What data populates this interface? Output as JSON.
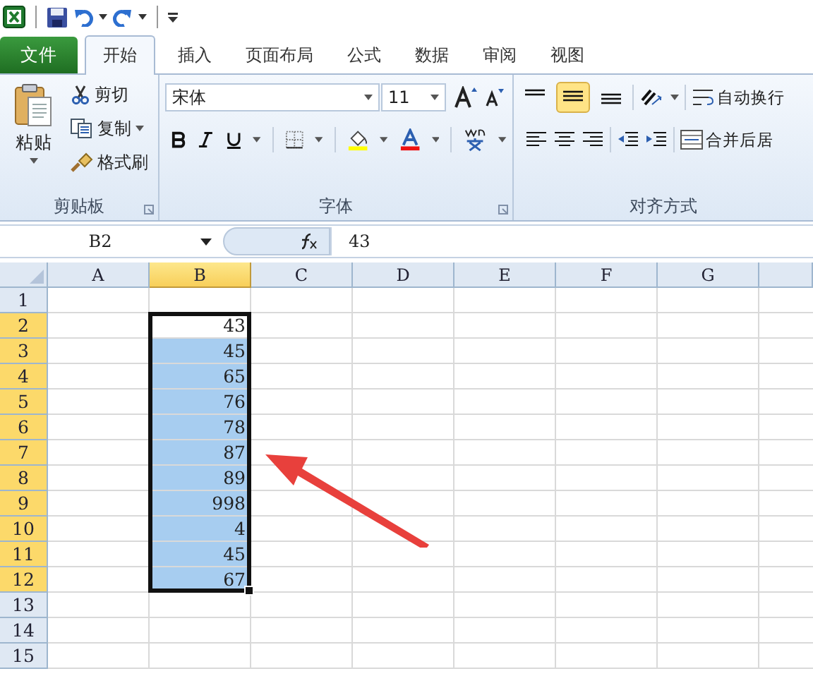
{
  "tabs": [
    {
      "label": "文件",
      "kind": "file",
      "selected": false
    },
    {
      "label": "开始",
      "kind": "tab",
      "selected": true
    },
    {
      "label": "插入",
      "kind": "tab",
      "selected": false
    },
    {
      "label": "页面布局",
      "kind": "tab",
      "selected": false
    },
    {
      "label": "公式",
      "kind": "tab",
      "selected": false
    },
    {
      "label": "数据",
      "kind": "tab",
      "selected": false
    },
    {
      "label": "审阅",
      "kind": "tab",
      "selected": false
    },
    {
      "label": "视图",
      "kind": "tab",
      "selected": false
    }
  ],
  "clipboard": {
    "label": "剪贴板",
    "paste": "粘贴",
    "cut": "剪切",
    "copy": "复制",
    "format_painter": "格式刷"
  },
  "font": {
    "label": "字体",
    "font_name": "宋体",
    "font_size": "11"
  },
  "alignment": {
    "label": "对齐方式",
    "vertical": [
      {
        "kind": "top",
        "selected": false
      },
      {
        "kind": "middle",
        "selected": true
      },
      {
        "kind": "bottom",
        "selected": false
      }
    ],
    "wrap_text": "自动换行",
    "merge_center": "合并后居"
  },
  "formula_bar": {
    "name_box": "B2",
    "formula": "43"
  },
  "columns": [
    {
      "label": "A",
      "selected": false
    },
    {
      "label": "B",
      "selected": true
    },
    {
      "label": "C",
      "selected": false
    },
    {
      "label": "D",
      "selected": false
    },
    {
      "label": "E",
      "selected": false
    },
    {
      "label": "F",
      "selected": false
    },
    {
      "label": "G",
      "selected": false
    }
  ],
  "rows": [
    {
      "header": "1",
      "selected": false,
      "active": false
    },
    {
      "header": "2",
      "selected": true,
      "active": true,
      "b": "43"
    },
    {
      "header": "3",
      "selected": true,
      "active": false,
      "b": "45"
    },
    {
      "header": "4",
      "selected": true,
      "active": false,
      "b": "65"
    },
    {
      "header": "5",
      "selected": true,
      "active": false,
      "b": "76"
    },
    {
      "header": "6",
      "selected": true,
      "active": false,
      "b": "78"
    },
    {
      "header": "7",
      "selected": true,
      "active": false,
      "b": "87"
    },
    {
      "header": "8",
      "selected": true,
      "active": false,
      "b": "89"
    },
    {
      "header": "9",
      "selected": true,
      "active": false,
      "b": "998"
    },
    {
      "header": "10",
      "selected": true,
      "active": false,
      "b": "4"
    },
    {
      "header": "11",
      "selected": true,
      "active": false,
      "b": "45"
    },
    {
      "header": "12",
      "selected": true,
      "active": false,
      "b": "67"
    },
    {
      "header": "13",
      "selected": false,
      "active": false
    },
    {
      "header": "14",
      "selected": false,
      "active": false
    },
    {
      "header": "15",
      "selected": false,
      "active": false
    }
  ]
}
